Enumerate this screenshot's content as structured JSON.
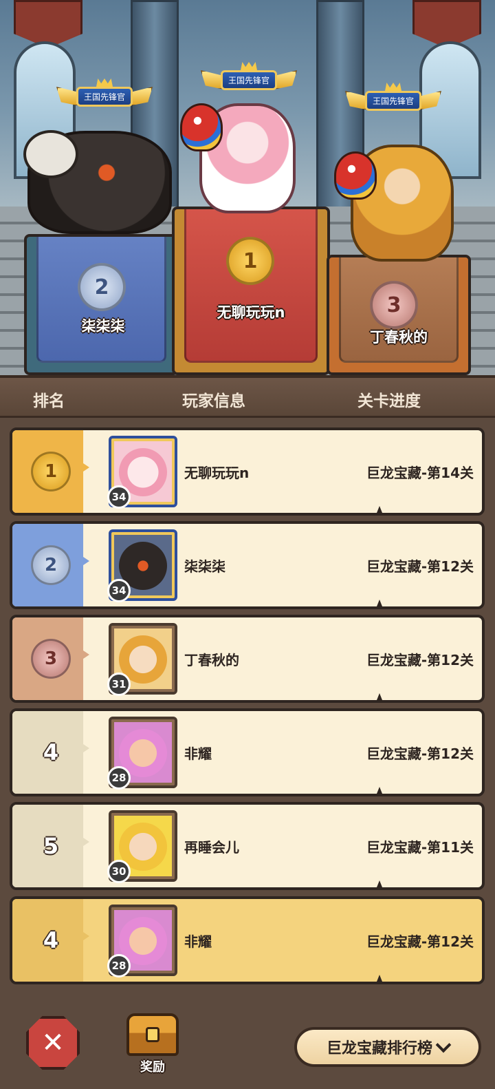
{
  "podium": {
    "title_badge": "王国先锋官",
    "first": {
      "rank": "1",
      "name": "无聊玩玩n"
    },
    "second": {
      "rank": "2",
      "name": "柒柒柒"
    },
    "third": {
      "rank": "3",
      "name": "丁春秋的"
    }
  },
  "header": {
    "rank_col": "排名",
    "player_col": "玩家信息",
    "progress_col": "关卡进度"
  },
  "rows": [
    {
      "rank": "1",
      "level": "34",
      "name": "无聊玩玩n",
      "stage": "巨龙宝藏-第14关"
    },
    {
      "rank": "2",
      "level": "34",
      "name": "柒柒柒",
      "stage": "巨龙宝藏-第12关"
    },
    {
      "rank": "3",
      "level": "31",
      "name": "丁春秋的",
      "stage": "巨龙宝藏-第12关"
    },
    {
      "rank": "4",
      "level": "28",
      "name": "非耀",
      "stage": "巨龙宝藏-第12关"
    },
    {
      "rank": "5",
      "level": "30",
      "name": "再睡会儿",
      "stage": "巨龙宝藏-第11关"
    }
  ],
  "my_row": {
    "rank": "4",
    "level": "28",
    "name": "非耀",
    "stage": "巨龙宝藏-第12关"
  },
  "footer": {
    "reward_label": "奖励",
    "board_select": "巨龙宝藏排行榜"
  },
  "colors": {
    "gold": "#efb548",
    "silver": "#7e9fdc",
    "bronze": "#d9a784",
    "row_bg": "#fbf1d8",
    "my_row_bg": "#f4d37e"
  }
}
